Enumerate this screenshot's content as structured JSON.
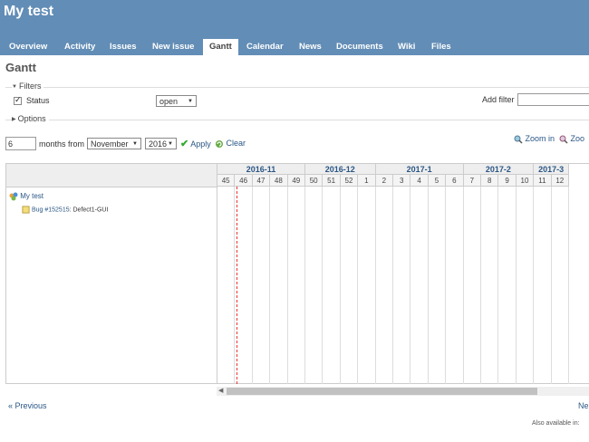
{
  "header": {
    "project_title": "My test"
  },
  "tabs": [
    {
      "label": "Overview"
    },
    {
      "label": "Activity"
    },
    {
      "label": "Issues"
    },
    {
      "label": "New issue"
    },
    {
      "label": "Gantt",
      "selected": true
    },
    {
      "label": "Calendar"
    },
    {
      "label": "News"
    },
    {
      "label": "Documents"
    },
    {
      "label": "Wiki"
    },
    {
      "label": "Files"
    }
  ],
  "page_title": "Gantt",
  "filters": {
    "legend": "Filters",
    "status_label": "Status",
    "status_checked": true,
    "status_value": "open",
    "add_filter_label": "Add filter"
  },
  "options": {
    "legend": "Options"
  },
  "range": {
    "months_value": "6",
    "months_from_label": "months from",
    "month_value": "November",
    "year_value": "2016",
    "apply_label": "Apply",
    "clear_label": "Clear"
  },
  "zoom": {
    "zoom_in_label": "Zoom in",
    "zoom_out_label": "Zoo"
  },
  "gantt": {
    "months": [
      "2016-11",
      "2016-12",
      "2017-1",
      "2017-2",
      "2017-3"
    ],
    "weeks": [
      "45",
      "46",
      "47",
      "48",
      "49",
      "50",
      "51",
      "52",
      "1",
      "2",
      "3",
      "4",
      "5",
      "6",
      "7",
      "8",
      "9",
      "10",
      "11",
      "12"
    ],
    "project": "My test",
    "issue_link": "Bug #152515",
    "issue_subject": ": Defect1-GUI"
  },
  "footer": {
    "previous_label": "« Previous",
    "next_label": "Ne",
    "also_available": "Also available in:"
  },
  "colors": {
    "header": "#628db6",
    "link": "#2a5685",
    "today_line": "#e33"
  }
}
